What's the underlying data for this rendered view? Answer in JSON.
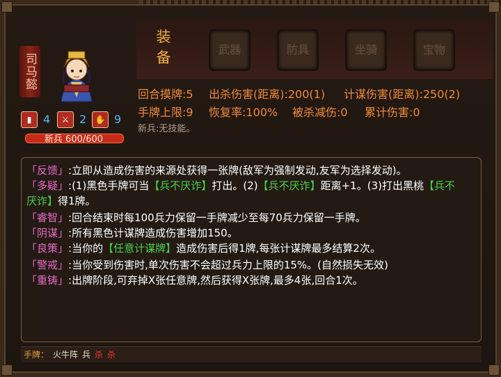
{
  "hero": {
    "name": "司马懿",
    "stat_cards": "4",
    "stat_attack": "2",
    "stat_defense": "9",
    "hp_label": "新兵 600/600"
  },
  "equipment": {
    "title": "装备",
    "slots": [
      "武器",
      "防具",
      "坐骑",
      "宝物"
    ]
  },
  "attributes": {
    "draw": "回合摸牌:5",
    "kill_damage": "出杀伤害(距离):200(1)",
    "strategy_damage": "计谋伤害(距离):250(2)",
    "hand_limit": "手牌上限:9",
    "recovery": "恢复率:100%",
    "damage_reduction": "被杀减伤:0",
    "total_damage": "累计伤害:0",
    "note": "新兵:无技能。"
  },
  "skills": [
    {
      "name": "「反馈」",
      "text": ":立即从造成伤害的来源处获得一张牌(敌军为强制发动,友军为选择发动)。"
    },
    {
      "name": "「多疑」",
      "t1": ":(1)黑色手牌可当",
      "h1": "【兵不厌诈】",
      "t2": "打出。(2)",
      "h2": "【兵不厌诈】",
      "t3": "距离+1。(3)打出黑桃",
      "h3": "【兵不",
      "h3b": "厌诈】",
      "t4": "得1牌。"
    },
    {
      "name": "「睿智」",
      "text": ":回合结束时每100兵力保留一手牌减少至每70兵力保留一手牌。"
    },
    {
      "name": "「阴谋」",
      "text": ":所有黑色计谋牌造成伤害增加150。"
    },
    {
      "name": "「良策」",
      "t1": ":当你的",
      "h1": "【任意计谋牌】",
      "t2": "造成伤害后得1牌,每张计谋牌最多结算2次。"
    },
    {
      "name": "「警戒」",
      "text": ":当你受到伤害时,单次伤害不会超过兵力上限的15%。(自然损失无效)"
    },
    {
      "name": "「重铸」",
      "text": ":出牌阶段,可弃掉X张任意牌,然后获得X张牌,最多4张,回合1次。"
    }
  ],
  "hand": {
    "label": "手牌：",
    "cards": [
      "火牛阵",
      "兵"
    ],
    "red_cards": [
      "杀",
      "杀"
    ]
  }
}
